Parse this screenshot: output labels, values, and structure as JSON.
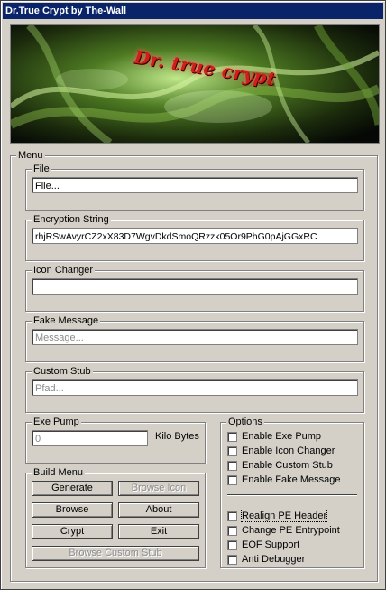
{
  "window": {
    "title": "Dr.True Crypt by The-Wall"
  },
  "banner": {
    "logo_text": "Dr. true crypt"
  },
  "menu": {
    "label": "Menu"
  },
  "file": {
    "label": "File",
    "value": "File..."
  },
  "encryption": {
    "label": "Encryption String",
    "value": "rhjRSwAvyrCZ2xX83D7WgvDkdSmoQRzzk05Or9PhG0pAjGGxRC"
  },
  "icon_changer": {
    "label": "Icon Changer",
    "value": ""
  },
  "fake_message": {
    "label": "Fake Message",
    "placeholder": "Message..."
  },
  "custom_stub": {
    "label": "Custom Stub",
    "placeholder": "Pfad..."
  },
  "exe_pump": {
    "label": "Exe Pump",
    "value": "0",
    "unit": "Kilo Bytes"
  },
  "build_menu": {
    "label": "Build Menu",
    "generate": "Generate",
    "browse_icon": "Browse Icon",
    "browse": "Browse",
    "about": "About",
    "crypt": "Crypt",
    "exit": "Exit",
    "browse_custom_stub": "Browse Custom Stub"
  },
  "options": {
    "label": "Options",
    "enable_exe_pump": "Enable Exe Pump",
    "enable_icon_changer": "Enable Icon Changer",
    "enable_custom_stub": "Enable Custom Stub",
    "enable_fake_message": "Enable Fake Message",
    "realign_pe_header": "Realign PE Header",
    "change_pe_entrypoint": "Change PE Entrypoint",
    "eof_support": "EOF Support",
    "anti_debugger": "Anti Debugger"
  }
}
